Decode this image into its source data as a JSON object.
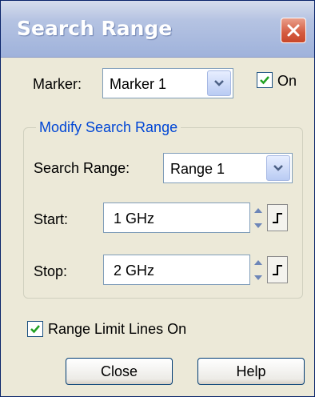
{
  "window": {
    "title": "Search Range",
    "close_icon": "close-icon"
  },
  "marker": {
    "label": "Marker:",
    "selected": "Marker 1",
    "on_label": "On",
    "on_checked": true
  },
  "group": {
    "title": "Modify Search Range",
    "search_range_label": "Search Range:",
    "search_range_selected": "Range 1",
    "start_label": "Start:",
    "start_value": "1 GHz",
    "stop_label": "Stop:",
    "stop_value": "2 GHz"
  },
  "range_limit": {
    "label": "Range Limit Lines On",
    "checked": true
  },
  "buttons": {
    "close_label": "Close",
    "help_label": "Help"
  },
  "colors": {
    "title_bar": "#9fb2db",
    "close_button": "#d45a3f",
    "group_title": "#0046d5",
    "dialog_bg": "#ece9d8"
  }
}
